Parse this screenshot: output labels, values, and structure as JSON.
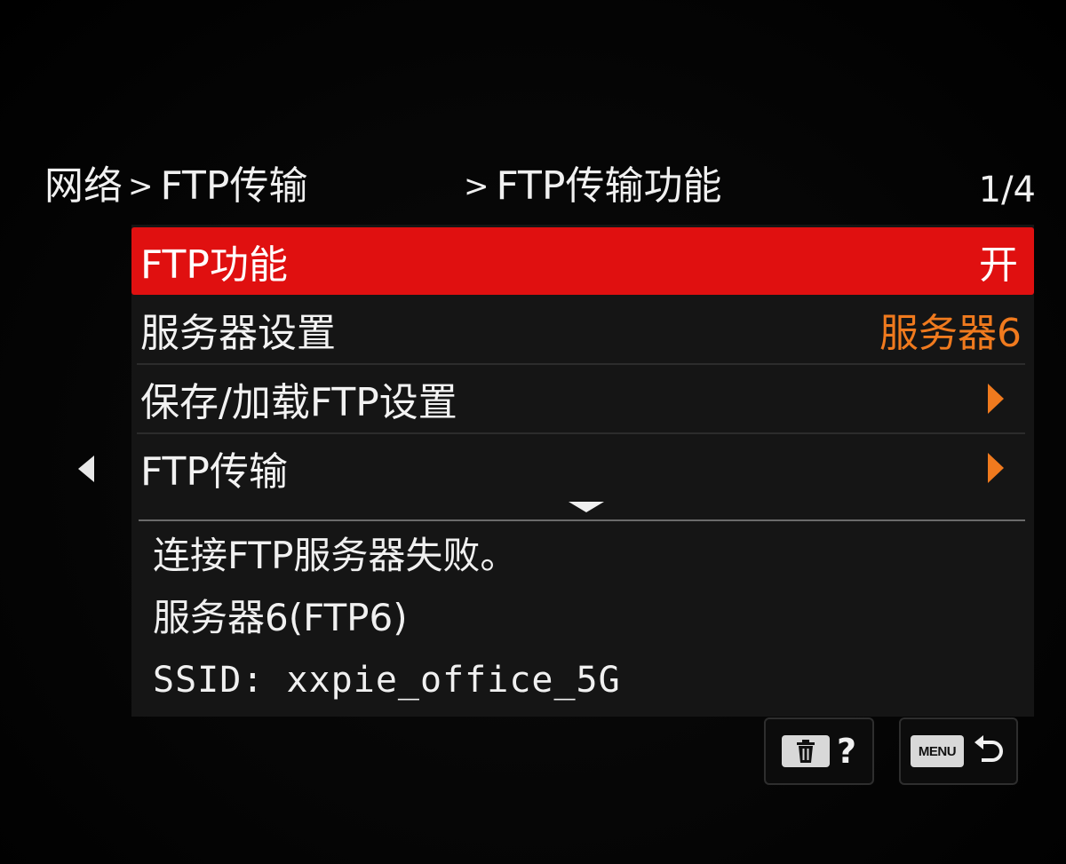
{
  "header": {
    "crumb_1": "网络",
    "crumb_2": "FTP传输",
    "crumb_3": "FTP传输功能",
    "separator": ">",
    "page_indicator": "1/4"
  },
  "menu": {
    "items": [
      {
        "label": "FTP功能",
        "value": "开",
        "selected": true
      },
      {
        "label": "服务器设置",
        "value": "服务器6",
        "selected": false
      },
      {
        "label": "保存/加载FTP设置",
        "value": "",
        "selected": false
      },
      {
        "label": "FTP传输",
        "value": "",
        "selected": false
      }
    ]
  },
  "info": {
    "line_1": "连接FTP服务器失败。",
    "line_2": "服务器6(FTP6)",
    "line_3": "SSID: xxpie_office_5G"
  },
  "buttons": {
    "help_symbol": "?",
    "menu_label": "MENU"
  },
  "colors": {
    "selected_row": "#e01010",
    "value_orange": "#f07a1e",
    "background": "#000000"
  }
}
